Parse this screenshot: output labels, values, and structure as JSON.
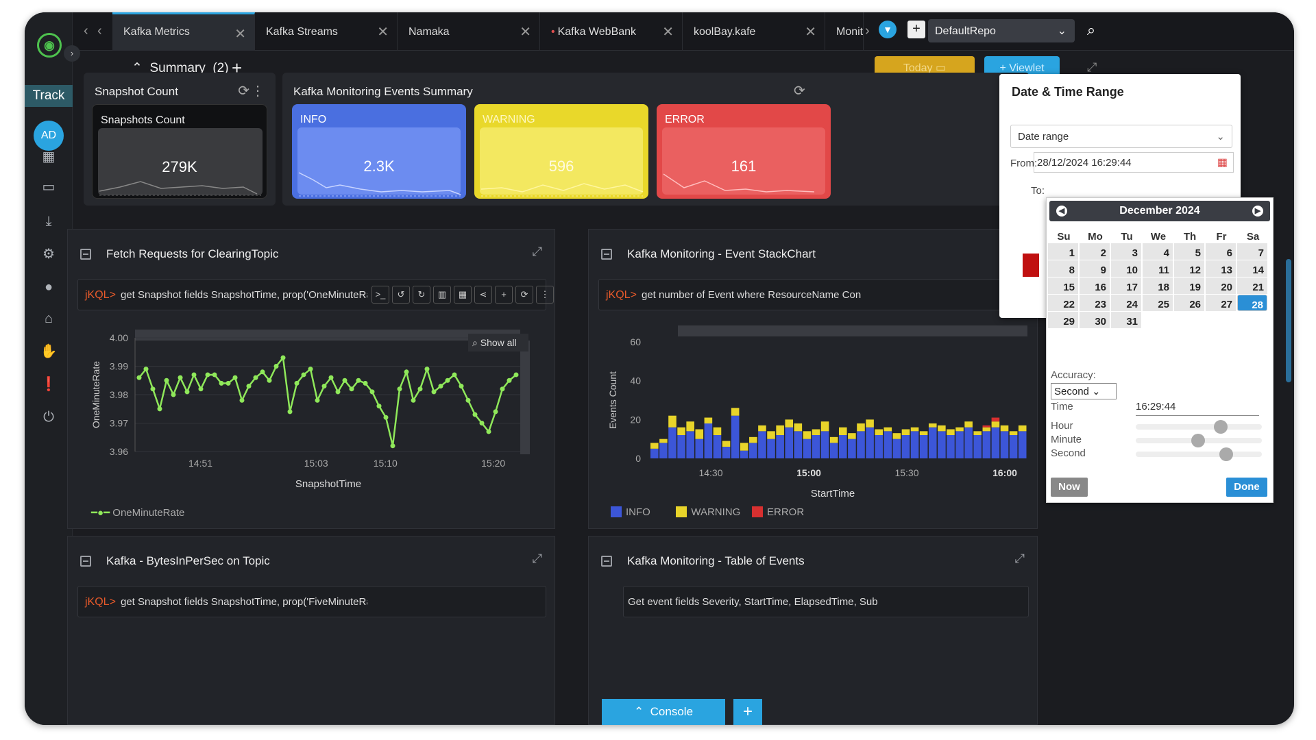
{
  "sidebar": {
    "track_label": "Track",
    "avatar_initials": "AD",
    "icons": [
      "grid-icon",
      "monitor-icon",
      "download-icon",
      "gear-icon",
      "user-icon",
      "home-icon",
      "thumbs-up-icon",
      "alert-icon",
      "power-icon"
    ]
  },
  "tabs": [
    {
      "label": "Kafka Metrics",
      "active": true
    },
    {
      "label": "Kafka Streams"
    },
    {
      "label": "Namaka"
    },
    {
      "label": "Kafka WebBank",
      "modified": true
    },
    {
      "label": "koolBay.kafe"
    },
    {
      "label": "Monit"
    }
  ],
  "header": {
    "repo": "DefaultRepo"
  },
  "summary": {
    "label": "Summary",
    "count": "(2)",
    "today": "Today",
    "viewlet": "+ Viewlet"
  },
  "snapshot_card": {
    "title": "Snapshot Count",
    "inner_label": "Snapshots Count",
    "value": "279K"
  },
  "events_card": {
    "title": "Kafka Monitoring Events Summary",
    "tiles": [
      {
        "label": "INFO",
        "value": "2.3K",
        "color": "#4a6fe0"
      },
      {
        "label": "WARNING",
        "value": "596",
        "color": "#e9d82a"
      },
      {
        "label": "ERROR",
        "value": "161",
        "color": "#e24848"
      }
    ]
  },
  "panel_fetch": {
    "title": "Fetch Requests  for ClearingTopic",
    "jkql": "jKQL>",
    "query": "get Snapshot fields SnapshotTime, prop('OneMinuteRate') as 'O",
    "show_all": "Show all",
    "legend": "OneMinuteRate"
  },
  "panel_stack": {
    "title": "Kafka Monitoring - Event StackChart",
    "jkql": "jKQL>",
    "query": "get number of Event where ResourceName Contains",
    "legend": [
      "INFO",
      "WARNING",
      "ERROR"
    ]
  },
  "panel_bytes": {
    "title": "Kafka - BytesInPerSec on Topic",
    "jkql": "jKQL>",
    "query": "get Snapshot fields SnapshotTime, prop('FiveMinuteRate') as 'Fi"
  },
  "panel_table": {
    "title": "Kafka Monitoring - Table of Events",
    "query": "Get event fields Severity, StartTime, ElapsedTime, Sub"
  },
  "console": {
    "label": "Console"
  },
  "datetime": {
    "title": "Date & Time Range",
    "mode": "Date range",
    "from_label": "From:",
    "from_value": "28/12/2024 16:29:44",
    "to_label": "To:",
    "calendar": {
      "month": "December 2024",
      "dow": [
        "Su",
        "Mo",
        "Tu",
        "We",
        "Th",
        "Fr",
        "Sa"
      ],
      "days": [
        "1",
        "2",
        "3",
        "4",
        "5",
        "6",
        "7",
        "8",
        "9",
        "10",
        "11",
        "12",
        "13",
        "14",
        "15",
        "16",
        "17",
        "18",
        "19",
        "20",
        "21",
        "22",
        "23",
        "24",
        "25",
        "26",
        "27",
        "28",
        "29",
        "30",
        "31"
      ],
      "selected": "28",
      "accuracy_label": "Accuracy:",
      "accuracy": "Second",
      "time_label": "Time",
      "time_value": "16:29:44",
      "hour_label": "Hour",
      "minute_label": "Minute",
      "second_label": "Second",
      "hour": 16,
      "minute": 29,
      "second": 44,
      "now": "Now",
      "done": "Done"
    }
  },
  "chart_data": [
    {
      "type": "line",
      "ylabel": "OneMinuteRate",
      "xlabel": "SnapshotTime",
      "ylim": [
        3.96,
        4.0
      ],
      "yticks": [
        "4.00",
        "3.99",
        "3.98",
        "3.97",
        "3.96"
      ],
      "xticks": [
        "14:51",
        "15:03",
        "15:10",
        "15:20"
      ],
      "series": [
        {
          "name": "OneMinuteRate",
          "color": "#8fe85a",
          "values": [
            3.986,
            3.989,
            3.982,
            3.975,
            3.985,
            3.98,
            3.986,
            3.981,
            3.987,
            3.982,
            3.987,
            3.987,
            3.984,
            3.984,
            3.986,
            3.978,
            3.983,
            3.986,
            3.988,
            3.985,
            3.99,
            3.993,
            3.974,
            3.984,
            3.987,
            3.989,
            3.978,
            3.983,
            3.986,
            3.981,
            3.985,
            3.982,
            3.985,
            3.984,
            3.981,
            3.976,
            3.972,
            3.962,
            3.982,
            3.988,
            3.978,
            3.982,
            3.989,
            3.981,
            3.983,
            3.985,
            3.987,
            3.983,
            3.978,
            3.973,
            3.97,
            3.967,
            3.974,
            3.982,
            3.985,
            3.987
          ]
        }
      ]
    },
    {
      "type": "bar",
      "stacked": true,
      "ylabel": "Events Count",
      "xlabel": "StartTime",
      "ylim": [
        0,
        60
      ],
      "yticks": [
        "60",
        "40",
        "20",
        "0"
      ],
      "xticks": [
        "14:30",
        "15:00",
        "15:30",
        "16:00"
      ],
      "series": [
        {
          "name": "INFO",
          "color": "#3c56d8",
          "values": [
            5,
            8,
            16,
            12,
            14,
            10,
            18,
            12,
            6,
            22,
            4,
            8,
            14,
            10,
            12,
            16,
            14,
            10,
            12,
            14,
            8,
            12,
            10,
            14,
            16,
            12,
            14,
            10,
            12,
            14,
            12,
            16,
            14,
            12,
            14,
            16,
            12,
            14,
            16,
            14,
            12,
            14
          ]
        },
        {
          "name": "WARNING",
          "color": "#e8d42a",
          "values": [
            3,
            2,
            6,
            4,
            5,
            5,
            3,
            4,
            3,
            4,
            4,
            3,
            3,
            4,
            5,
            4,
            4,
            4,
            3,
            5,
            3,
            4,
            3,
            4,
            4,
            3,
            2,
            3,
            3,
            2,
            2,
            2,
            3,
            3,
            2,
            3,
            2,
            2,
            3,
            3,
            2,
            3
          ]
        },
        {
          "name": "ERROR",
          "color": "#d83030",
          "values": [
            0,
            0,
            0,
            0,
            0,
            0,
            0,
            0,
            0,
            0,
            0,
            0,
            0,
            0,
            0,
            0,
            0,
            0,
            0,
            0,
            0,
            0,
            0,
            0,
            0,
            0,
            0,
            0,
            0,
            0,
            0,
            0,
            0,
            0,
            0,
            0,
            0,
            1,
            2,
            0,
            0,
            0
          ]
        }
      ]
    }
  ]
}
